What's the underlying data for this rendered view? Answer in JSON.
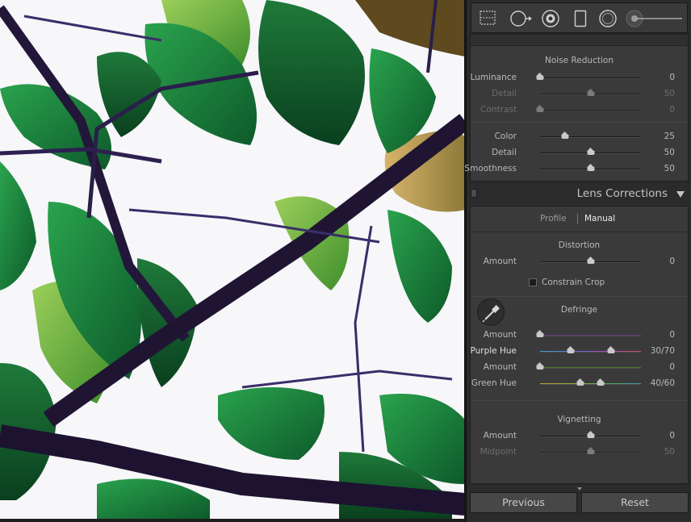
{
  "tools": [
    {
      "name": "crop-overlay-icon"
    },
    {
      "name": "spot-removal-icon"
    },
    {
      "name": "red-eye-icon"
    },
    {
      "name": "graduated-filter-icon"
    },
    {
      "name": "radial-filter-icon"
    },
    {
      "name": "adjustment-brush-icon"
    }
  ],
  "noise_reduction": {
    "title": "Noise Reduction",
    "luminance": {
      "label": "Luminance",
      "value": "0",
      "level": 0.0
    },
    "detail": {
      "label": "Detail",
      "value": "50",
      "level": 0.5
    },
    "contrast": {
      "label": "Contrast",
      "value": "0",
      "level": 0.0
    },
    "color": {
      "label": "Color",
      "value": "25",
      "level": 0.25
    },
    "color_detail": {
      "label": "Detail",
      "value": "50",
      "level": 0.5
    },
    "smoothness": {
      "label": "Smoothness",
      "value": "50",
      "level": 0.5
    }
  },
  "lens_corrections": {
    "title": "Lens Corrections",
    "tabs": {
      "profile": "Profile",
      "manual": "Manual"
    },
    "distortion": {
      "title": "Distortion",
      "amount": {
        "label": "Amount",
        "value": "0",
        "level": 0.5
      },
      "constrain_crop": "Constrain Crop"
    },
    "defringe": {
      "title": "Defringe",
      "purple_amount": {
        "label": "Amount",
        "value": "0",
        "level": 0.0
      },
      "purple_hue": {
        "label": "Purple Hue",
        "value": "30/70",
        "level_low": 0.3,
        "level_high": 0.7
      },
      "green_amount": {
        "label": "Amount",
        "value": "0",
        "level": 0.0
      },
      "green_hue": {
        "label": "Green Hue",
        "value": "40/60",
        "level_low": 0.4,
        "level_high": 0.6
      }
    },
    "vignetting": {
      "title": "Vignetting",
      "amount": {
        "label": "Amount",
        "value": "0",
        "level": 0.5
      },
      "midpoint": {
        "label": "Midpoint",
        "value": "50",
        "level": 0.5
      }
    }
  },
  "buttons": {
    "previous": "Previous",
    "reset": "Reset"
  },
  "colors": {
    "panel": "#3a3a3a",
    "purple_track": "#8a5fb8",
    "green_track": "#6fae3c",
    "leaf": "#1f8a3d",
    "branch": "#25183e"
  }
}
